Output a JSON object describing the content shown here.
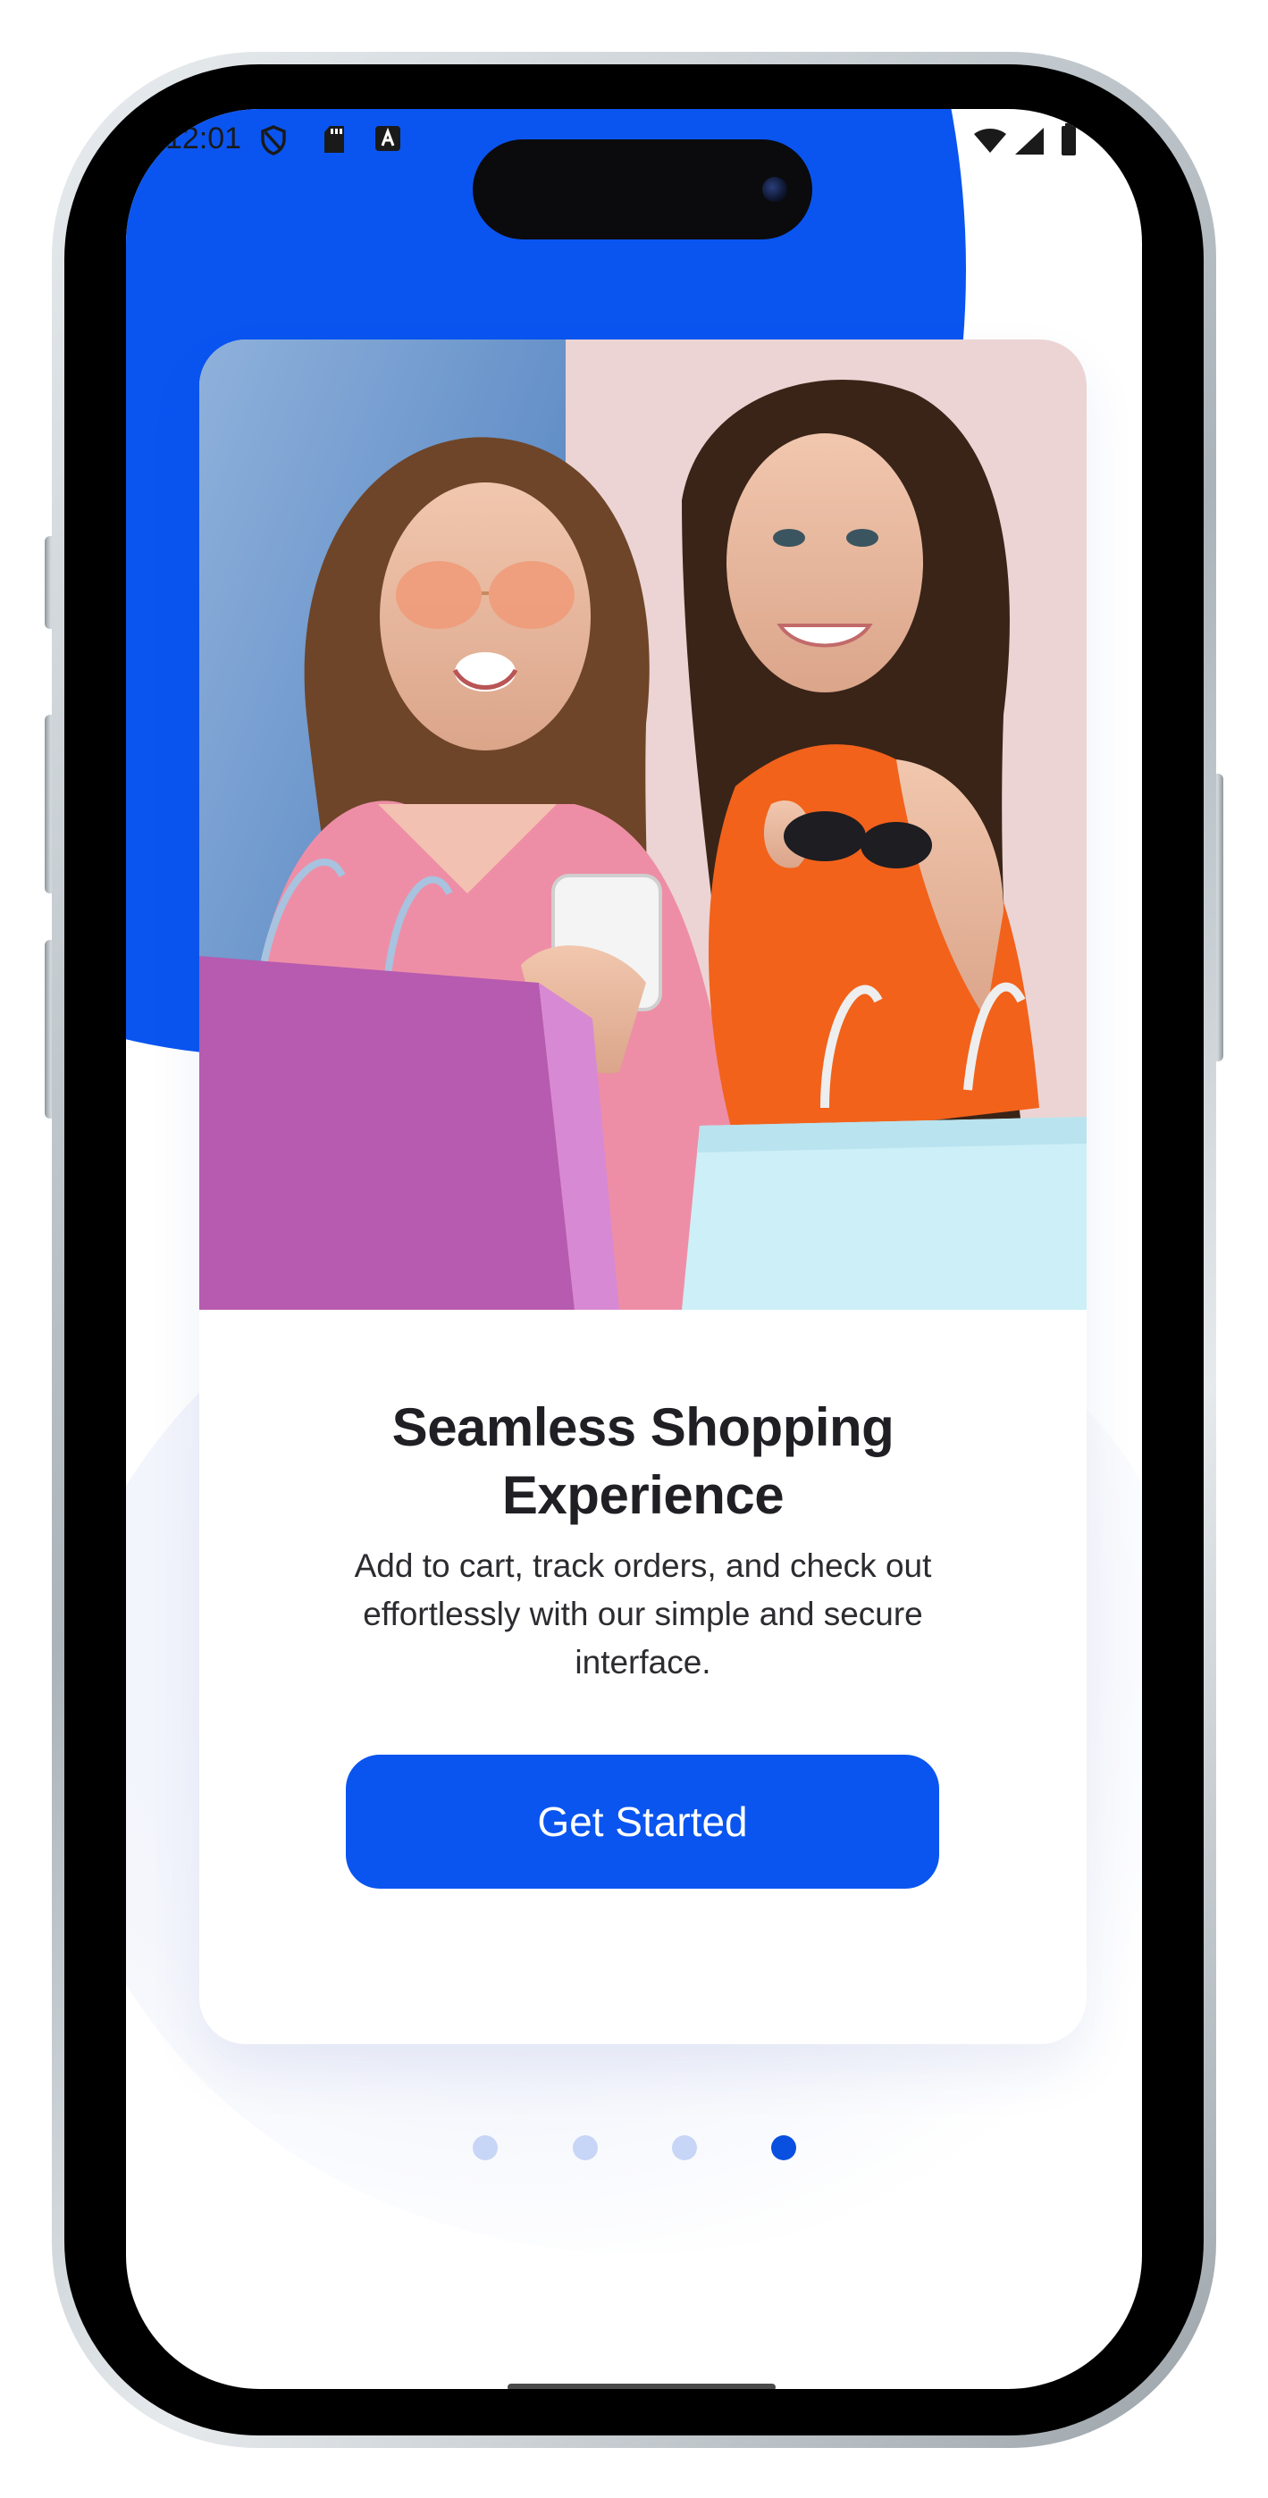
{
  "status_bar": {
    "time": "12:01",
    "left_icons": [
      "shield-icon",
      "sd-card-icon",
      "a-badge-icon"
    ],
    "right_icons": [
      "wifi-icon",
      "cellular-icon",
      "battery-icon"
    ]
  },
  "onboarding": {
    "hero_image": "two-women-shopping-bags-photo",
    "title": "Seamless Shopping Experience",
    "description": "Add to cart, track orders, and check out effortlessly with our simple and secure interface.",
    "cta_label": "Get Started"
  },
  "pagination": {
    "total": 4,
    "active_index": 3
  },
  "colors": {
    "accent": "#0a55f0",
    "dot_inactive": "#c7d5f6",
    "dot_active": "#0a50e0",
    "title_text": "#1f1f24",
    "body_text": "#2b2b30"
  }
}
